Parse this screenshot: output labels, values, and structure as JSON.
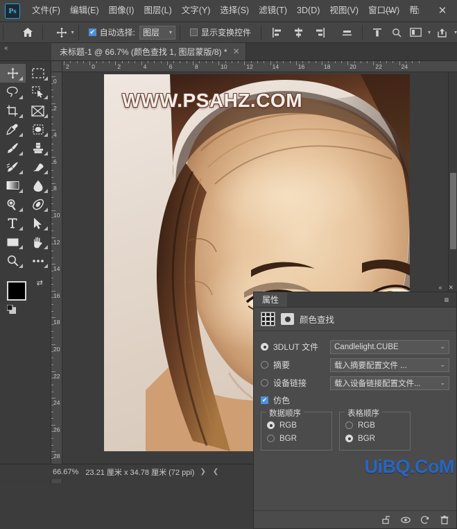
{
  "app": {
    "name": "Photoshop",
    "logo_text": "Ps"
  },
  "menubar": {
    "items": [
      {
        "label": "文件(F)",
        "name": "menu-file"
      },
      {
        "label": "编辑(E)",
        "name": "menu-edit"
      },
      {
        "label": "图像(I)",
        "name": "menu-image"
      },
      {
        "label": "图层(L)",
        "name": "menu-layer"
      },
      {
        "label": "文字(Y)",
        "name": "menu-type"
      },
      {
        "label": "选择(S)",
        "name": "menu-select"
      },
      {
        "label": "滤镜(T)",
        "name": "menu-filter"
      },
      {
        "label": "3D(D)",
        "name": "menu-3d"
      },
      {
        "label": "视图(V)",
        "name": "menu-view"
      },
      {
        "label": "窗口(W)",
        "name": "menu-window"
      },
      {
        "label": "帮",
        "name": "menu-help"
      }
    ],
    "window_controls": {
      "minimize": "—",
      "maximize": "□",
      "close": "✕"
    }
  },
  "options_bar": {
    "auto_select_label": "自动选择:",
    "auto_select_checked": true,
    "layer_select_value": "图层",
    "show_transform_label": "显示变换控件",
    "show_transform_checked": false
  },
  "document_tab": {
    "title": "未标题-1 @ 66.7% (颜色查找 1, 图层蒙版/8) *",
    "close_glyph": "✕"
  },
  "toolbox": {
    "tools": [
      {
        "name": "move-tool",
        "active": true
      },
      {
        "name": "marquee-tool",
        "active": false
      },
      {
        "name": "lasso-tool",
        "active": false
      },
      {
        "name": "quick-selection-tool",
        "active": false
      },
      {
        "name": "crop-tool",
        "active": false
      },
      {
        "name": "frame-tool",
        "active": false
      },
      {
        "name": "eyedropper-tool",
        "active": false
      },
      {
        "name": "healing-brush-tool",
        "active": false
      },
      {
        "name": "brush-tool",
        "active": false
      },
      {
        "name": "clone-stamp-tool",
        "active": false
      },
      {
        "name": "history-brush-tool",
        "active": false
      },
      {
        "name": "eraser-tool",
        "active": false
      },
      {
        "name": "gradient-tool",
        "active": false
      },
      {
        "name": "blur-tool",
        "active": false
      },
      {
        "name": "dodge-tool",
        "active": false
      },
      {
        "name": "pen-tool",
        "active": false
      },
      {
        "name": "type-tool",
        "active": false
      },
      {
        "name": "path-selection-tool",
        "active": false
      },
      {
        "name": "rectangle-tool",
        "active": false
      },
      {
        "name": "hand-tool",
        "active": false
      },
      {
        "name": "zoom-tool",
        "active": false
      },
      {
        "name": "edit-toolbar-tool",
        "active": false
      }
    ],
    "foreground_color": "#000000",
    "background_color": "#b9b9b9"
  },
  "rulers": {
    "horizontal_unit_labels": [
      "2",
      "0",
      "2",
      "4",
      "6",
      "8",
      "10",
      "12",
      "14",
      "16",
      "18",
      "20",
      "22",
      "24"
    ],
    "vertical_unit_labels": [
      "0",
      "2",
      "4",
      "6",
      "8",
      "10",
      "12",
      "14",
      "16",
      "18",
      "20",
      "22",
      "24",
      "26",
      "28"
    ]
  },
  "canvas": {
    "watermark_text": "WWW.PSAHZ.COM"
  },
  "properties_panel": {
    "tab_label": "属性",
    "header_title": "颜色查找",
    "panel_collapse_glyph": "«",
    "panel_close_glyph": "✕",
    "panel_menu_glyph": "≡",
    "rows": [
      {
        "name": "3dlut-file",
        "label": "3DLUT 文件",
        "selected": true,
        "value": "Candlelight.CUBE"
      },
      {
        "name": "abstract",
        "label": "摘要",
        "selected": false,
        "value": "载入摘要配置文件 ..."
      },
      {
        "name": "device-link",
        "label": "设备链接",
        "selected": false,
        "value": "载入设备链接配置文件..."
      }
    ],
    "dither": {
      "label": "仿色",
      "checked": true
    },
    "fieldsets": [
      {
        "name": "data-order",
        "legend": "数据顺序",
        "options": [
          {
            "label": "RGB",
            "selected": true
          },
          {
            "label": "BGR",
            "selected": false
          }
        ]
      },
      {
        "name": "table-order",
        "legend": "表格顺序",
        "options": [
          {
            "label": "RGB",
            "selected": false
          },
          {
            "label": "BGR",
            "selected": true
          }
        ]
      }
    ]
  },
  "status_bar": {
    "zoom": "66.67%",
    "dimensions": "23.21 厘米 x 34.78 厘米 (72 ppi)",
    "arrow_right": "❯",
    "arrow_left": "❮"
  },
  "overlay_watermark": {
    "text": "UiBQ.CoM",
    "color": "#2566c4"
  }
}
